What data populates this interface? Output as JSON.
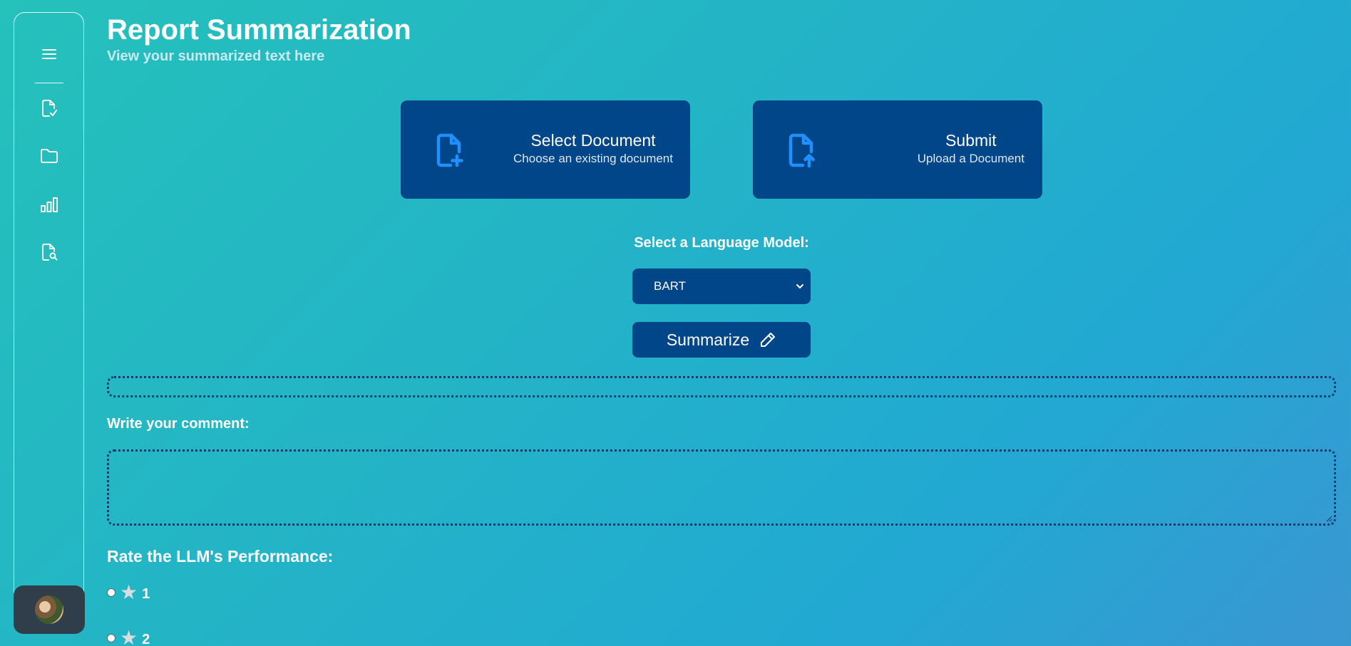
{
  "header": {
    "title": "Report Summarization",
    "subtitle": "View your summarized text here"
  },
  "sidebar": {
    "items": [
      {
        "name": "menu-icon"
      },
      {
        "name": "file-check-icon"
      },
      {
        "name": "folder-icon"
      },
      {
        "name": "bar-chart-icon"
      },
      {
        "name": "file-search-icon"
      }
    ],
    "profile_icon": "avatar"
  },
  "cards": {
    "select": {
      "title": "Select Document",
      "subtitle": "Choose an existing document",
      "icon": "file-plus-icon"
    },
    "submit": {
      "title": "Submit",
      "subtitle": "Upload a Document",
      "icon": "file-upload-icon"
    }
  },
  "model": {
    "label": "Select a Language Model:",
    "selected": "BART"
  },
  "summarize": {
    "label": "Summarize",
    "icon": "pencil-icon"
  },
  "summary_output": {
    "text": ""
  },
  "comment": {
    "label": "Write your comment:",
    "value": ""
  },
  "rating": {
    "label": "Rate the LLM's Performance:",
    "options": [
      "1",
      "2"
    ]
  },
  "colors": {
    "card_bg": "#02468a",
    "icon_blue": "#1e90ff",
    "border_dotted": "#0a3f6e",
    "profile_bg": "#2f3e4a"
  }
}
